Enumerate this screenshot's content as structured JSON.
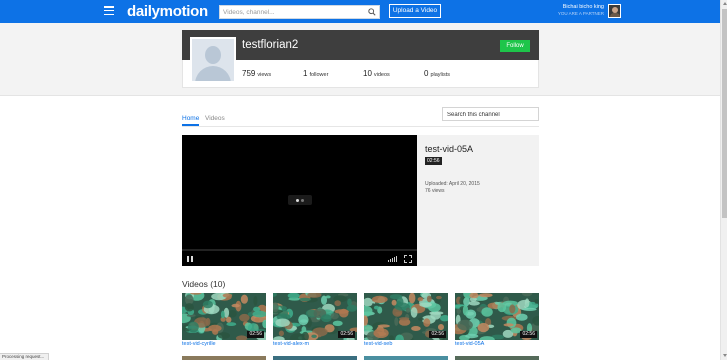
{
  "nav": {
    "logo": "dailymotion",
    "search_placeholder": "Videos, channel...",
    "upload_label": "Upload a Video",
    "user_name": "Bichai bicho king",
    "user_role": "YOU ARE A PARTNER",
    "brand_color": "#0d72e6",
    "icons": [
      "menu-icon",
      "search-icon",
      "avatar"
    ]
  },
  "channel": {
    "name": "testflorian2",
    "follow_label": "Follow",
    "follow_color": "#1ec54a",
    "stats": [
      {
        "value": "759",
        "label": "views"
      },
      {
        "value": "1",
        "label": "follower"
      },
      {
        "value": "10",
        "label": "videos"
      },
      {
        "value": "0",
        "label": "playlists"
      }
    ]
  },
  "tabs": [
    {
      "label": "Home",
      "active": true
    },
    {
      "label": "Videos",
      "active": false
    }
  ],
  "channel_search": {
    "placeholder": "Search this channel"
  },
  "featured": {
    "title": "test-vid-05A",
    "duration": "02:56",
    "uploaded": "Uploaded: April 20, 2015",
    "views": "76 views",
    "player_icons": [
      "pause-icon",
      "quality-icon",
      "fullscreen-icon"
    ]
  },
  "videos": {
    "heading": "Videos (10)",
    "items": [
      {
        "title": "test-vid-cyrille",
        "duration": "02:56"
      },
      {
        "title": "test-vid-alex-m",
        "duration": "02:56"
      },
      {
        "title": "test-vid-seb",
        "duration": "02:56"
      },
      {
        "title": "test-vid-05A",
        "duration": "02:56"
      }
    ]
  },
  "status": "Processing request..."
}
